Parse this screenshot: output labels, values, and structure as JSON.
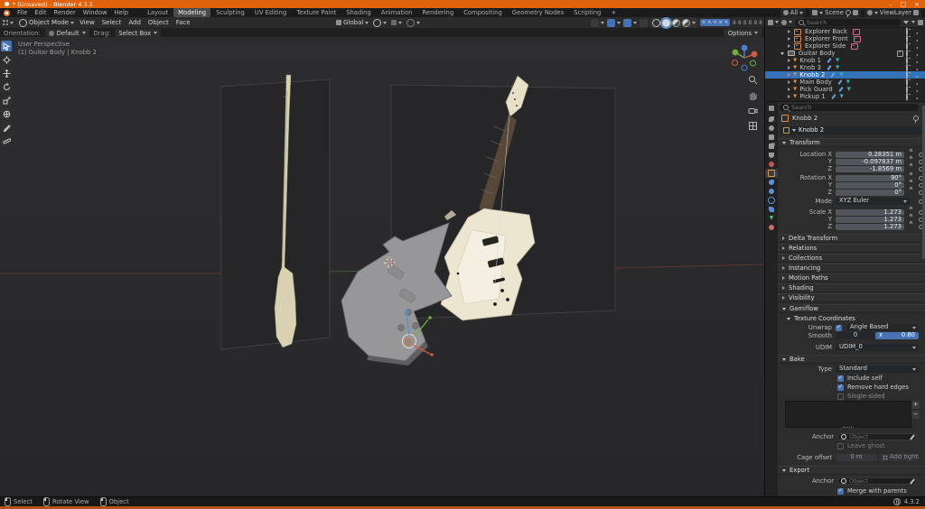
{
  "colors": {
    "accent_blue": "#4772b3",
    "selection_blue": "#3672b8",
    "titlebar_orange": "#e1620d",
    "object_orange": "#d98a4a",
    "mesh_teal": "#35b5b0",
    "guitar_cream": "#ece5d0",
    "model_gray": "#97979a"
  },
  "window": {
    "title": "* (Unsaved) - Blender 4.3.2",
    "min": "–",
    "max": "□",
    "close": "×"
  },
  "topbar": {
    "menus": [
      "File",
      "Edit",
      "Render",
      "Window",
      "Help"
    ],
    "workspaces": [
      "Layout",
      "Modeling",
      "Sculpting",
      "UV Editing",
      "Texture Paint",
      "Shading",
      "Animation",
      "Rendering",
      "Compositing",
      "Geometry Nodes",
      "Scripting"
    ],
    "active_workspace": "Modeling",
    "add_workspace": "+",
    "all_label": "All",
    "scene_label": "Scene",
    "viewlayer_label": "ViewLayer"
  },
  "viewport": {
    "mode": "Object Mode",
    "menus": [
      "View",
      "Select",
      "Add",
      "Object",
      "Face"
    ],
    "orientation": "Global",
    "options_label": "Options",
    "tool_settings": {
      "orientation_label": "Orientation:",
      "orientation_value": "Default",
      "drag_label": "Drag:",
      "drag_value": "Select Box"
    },
    "overlay_line1": "User Perspective",
    "overlay_line2": "(1) Guitar Body | Knobb 2"
  },
  "outliner": {
    "search_placeholder": "Search",
    "rows": [
      {
        "name": "Explorer Back",
        "type": "empty-image"
      },
      {
        "name": "Explorer Front",
        "type": "empty-image"
      },
      {
        "name": "Explorer Side",
        "type": "empty-image"
      },
      {
        "name": "Guitar Body",
        "type": "collection"
      },
      {
        "name": "Knob 1",
        "type": "mesh"
      },
      {
        "name": "Knob 3",
        "type": "mesh"
      },
      {
        "name": "Knobb 2",
        "type": "mesh",
        "selected": true
      },
      {
        "name": "Main Body",
        "type": "mesh"
      },
      {
        "name": "Pick Guard",
        "type": "mesh"
      },
      {
        "name": "Pickup 1",
        "type": "mesh"
      }
    ]
  },
  "properties": {
    "search_placeholder": "Search",
    "breadcrumb": "Knobb 2",
    "object_name": "Knobb 2",
    "transform": {
      "title": "Transform",
      "rows": [
        {
          "label": "Location X",
          "value": "0.28351 m"
        },
        {
          "label": "Y",
          "value": "-0.097837 m"
        },
        {
          "label": "Z",
          "value": "-1.8569 m"
        },
        {
          "label": "Rotation X",
          "value": "90°"
        },
        {
          "label": "Y",
          "value": "0°"
        },
        {
          "label": "Z",
          "value": "0°"
        },
        {
          "label": "Scale X",
          "value": "1.273"
        },
        {
          "label": "Y",
          "value": "1.273"
        },
        {
          "label": "Z",
          "value": "1.273"
        }
      ],
      "mode_label": "Mode",
      "mode_value": "XYZ Euler"
    },
    "collapsed_panels": [
      "Delta Transform",
      "Relations",
      "Collections",
      "Instancing",
      "Motion Paths",
      "Shading",
      "Visibility"
    ],
    "gamiflow": {
      "title": "Gamiflow",
      "texcoords_title": "Texture Coordinates",
      "unwrap_label": "Unwrap",
      "unwrap_value": "Angle Based",
      "smooth_label": "Smooth",
      "smooth_a": "0",
      "smooth_x": "x",
      "smooth_b": "0.80",
      "udim_label": "UDIM",
      "udim_value": "UDIM_0"
    },
    "bake": {
      "title": "Bake",
      "type_label": "Type",
      "type_value": "Standard",
      "include_label": "Include self",
      "remove_label": "Remove hard edges",
      "single_label": "Single-sided",
      "anchor_label": "Anchor",
      "anchor_placeholder": "Object",
      "leave_ghost_label": "Leave ghost",
      "cage_label": "Cage offset",
      "cage_value": "0 m",
      "tightness_label": "Add tightness..."
    },
    "export": {
      "title": "Export",
      "anchor_label": "Anchor",
      "anchor_placeholder": "Object",
      "merge_label": "Merge with parents"
    }
  },
  "statusbar": {
    "items": [
      "Select",
      "Rotate View",
      "Object"
    ],
    "version": "4.3.2"
  }
}
